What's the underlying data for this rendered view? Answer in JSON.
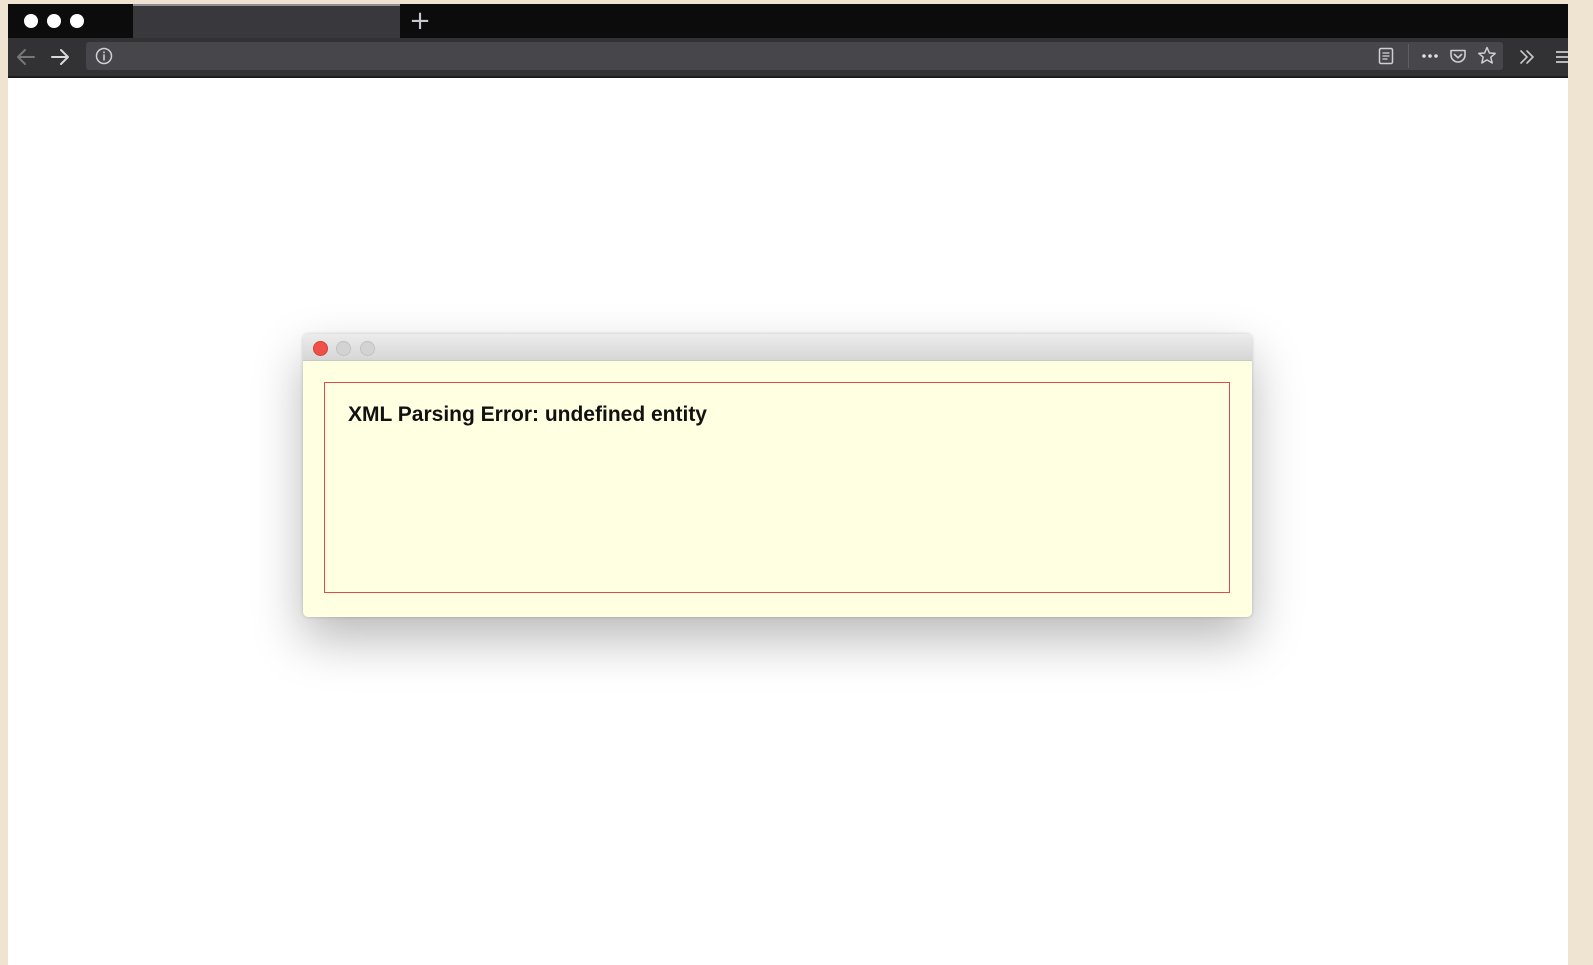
{
  "browser": {
    "new_tab_label": "+",
    "url": ""
  },
  "dialog": {
    "error_title": "XML Parsing Error: undefined entity"
  },
  "colors": {
    "dialog_bg": "#ffffe1",
    "error_border": "#e24b4b",
    "close_light": "#f0504a",
    "tab_strip": "#0c0c0d",
    "nav_bar": "#323234"
  },
  "icons": [
    "back-arrow-icon",
    "forward-arrow-icon",
    "info-icon",
    "reader-view-icon",
    "more-actions-icon",
    "pocket-icon",
    "bookmark-star-icon",
    "overflow-chevron-icon",
    "hamburger-menu-icon"
  ]
}
